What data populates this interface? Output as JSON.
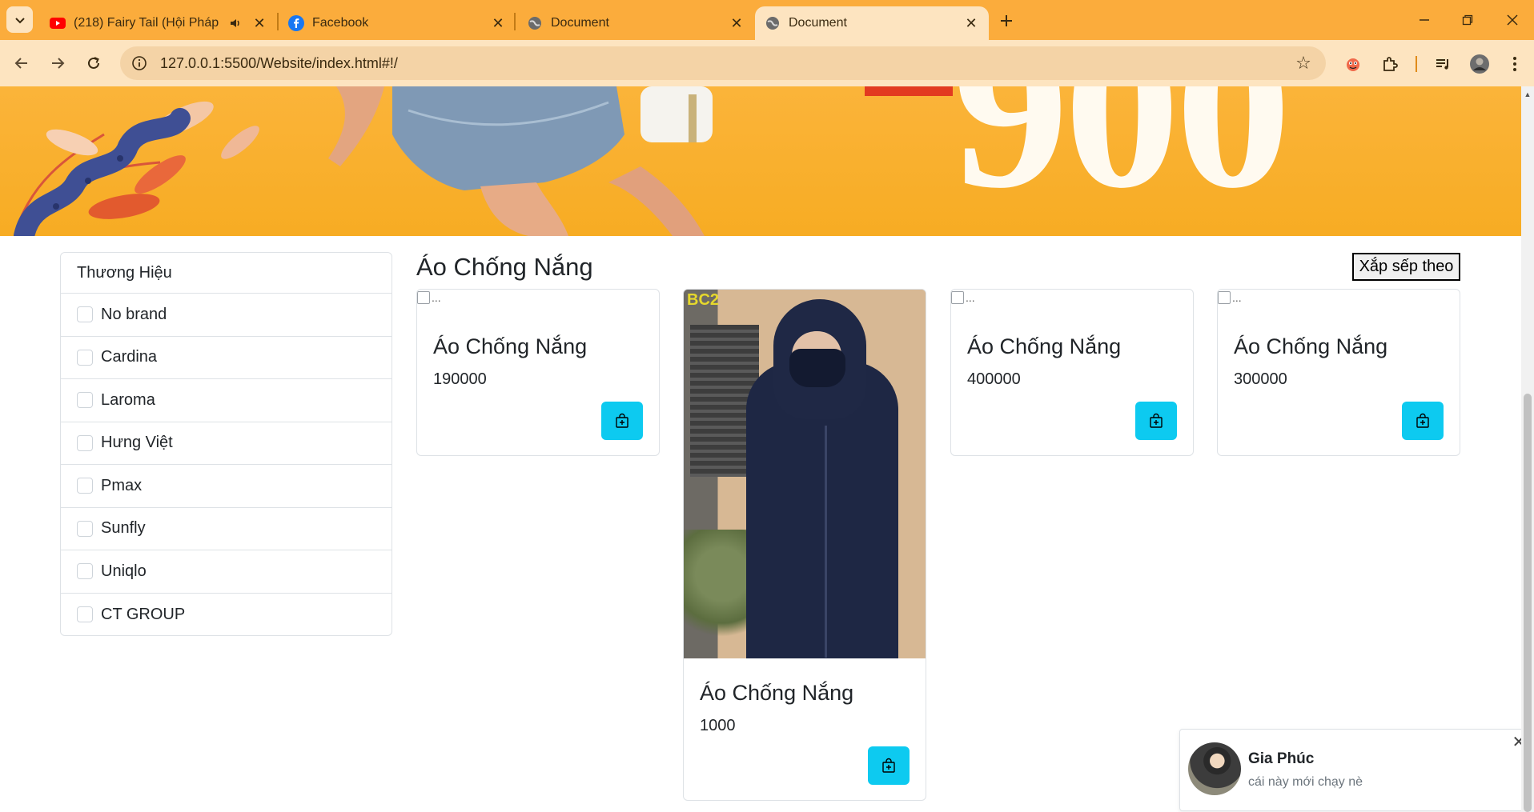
{
  "browser": {
    "tabs": [
      {
        "title": "(218) Fairy Tail (Hội Pháp Sư",
        "favicon": "youtube-icon",
        "audio": true
      },
      {
        "title": "Facebook",
        "favicon": "facebook-icon"
      },
      {
        "title": "Document",
        "favicon": "globe-icon"
      },
      {
        "title": "Document",
        "favicon": "globe-icon",
        "active": true
      }
    ],
    "url": "127.0.0.1:5500/Website/index.html#!/",
    "colors": {
      "frame": "#fbac3c",
      "toolbar": "#fde4c0",
      "omnibox": "#f4d3a6"
    }
  },
  "banner": {
    "promo_text": "900"
  },
  "filter": {
    "title": "Thương Hiệu",
    "brands": [
      "No brand",
      "Cardina",
      "Laroma",
      "Hưng Việt",
      "Pmax",
      "Sunfly",
      "Uniqlo",
      "CT GROUP"
    ]
  },
  "products": {
    "section_title": "Áo Chống Nắng",
    "sort_label": "Xắp sếp theo",
    "broken_image_alt": "...",
    "photo_label": "BC2",
    "items": [
      {
        "name": "Áo Chống Nắng",
        "price": "190000"
      },
      {
        "name": "Áo Chống Nắng",
        "price": "1000"
      },
      {
        "name": "Áo Chống Nắng",
        "price": "400000"
      },
      {
        "name": "Áo Chống Nắng",
        "price": "300000"
      }
    ],
    "accent_color": "#0dcaf0"
  },
  "chat_toast": {
    "name": "Gia Phúc",
    "message": "cái này mới chạy nè"
  }
}
